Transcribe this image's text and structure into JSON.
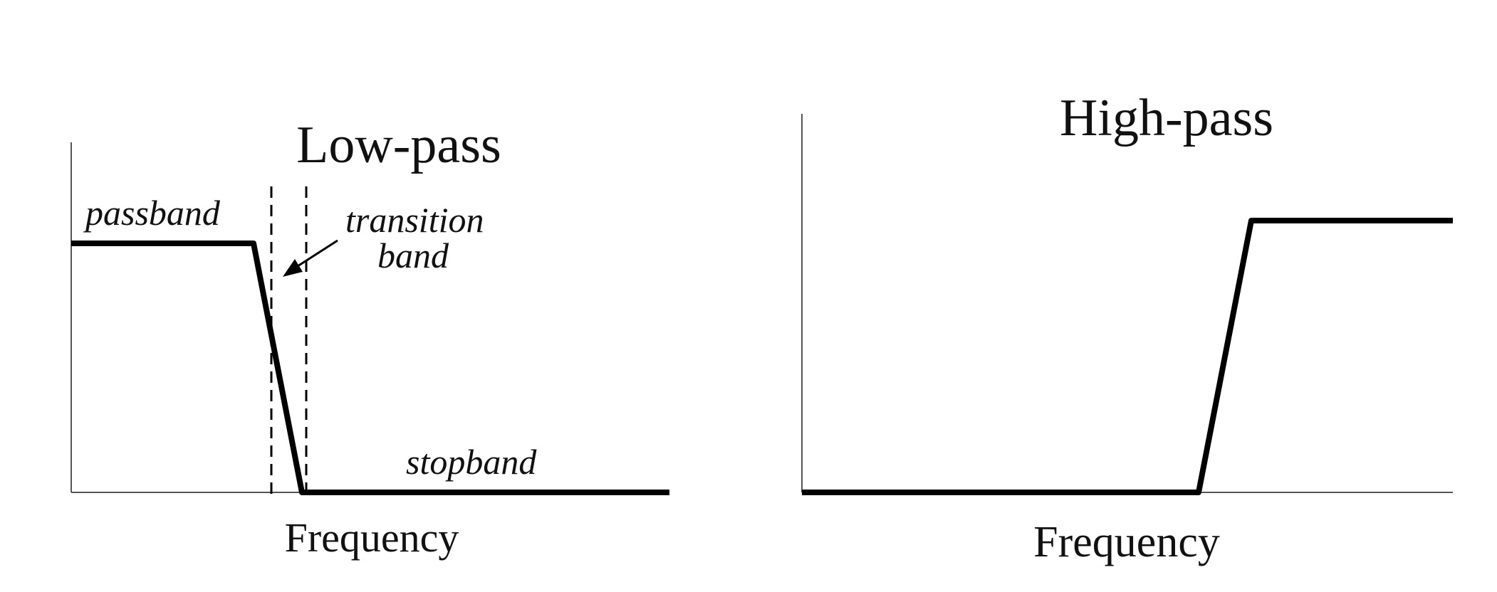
{
  "panels": [
    {
      "title": "Low-pass",
      "xlabel": "Frequency",
      "annotations": {
        "passband": "passband",
        "transition_line1": "transition",
        "transition_line2": "band",
        "stopband": "stopband"
      }
    },
    {
      "title": "High-pass",
      "xlabel": "Frequency"
    }
  ],
  "style": {
    "line_color": "#000000",
    "axis_color": "#555555"
  }
}
